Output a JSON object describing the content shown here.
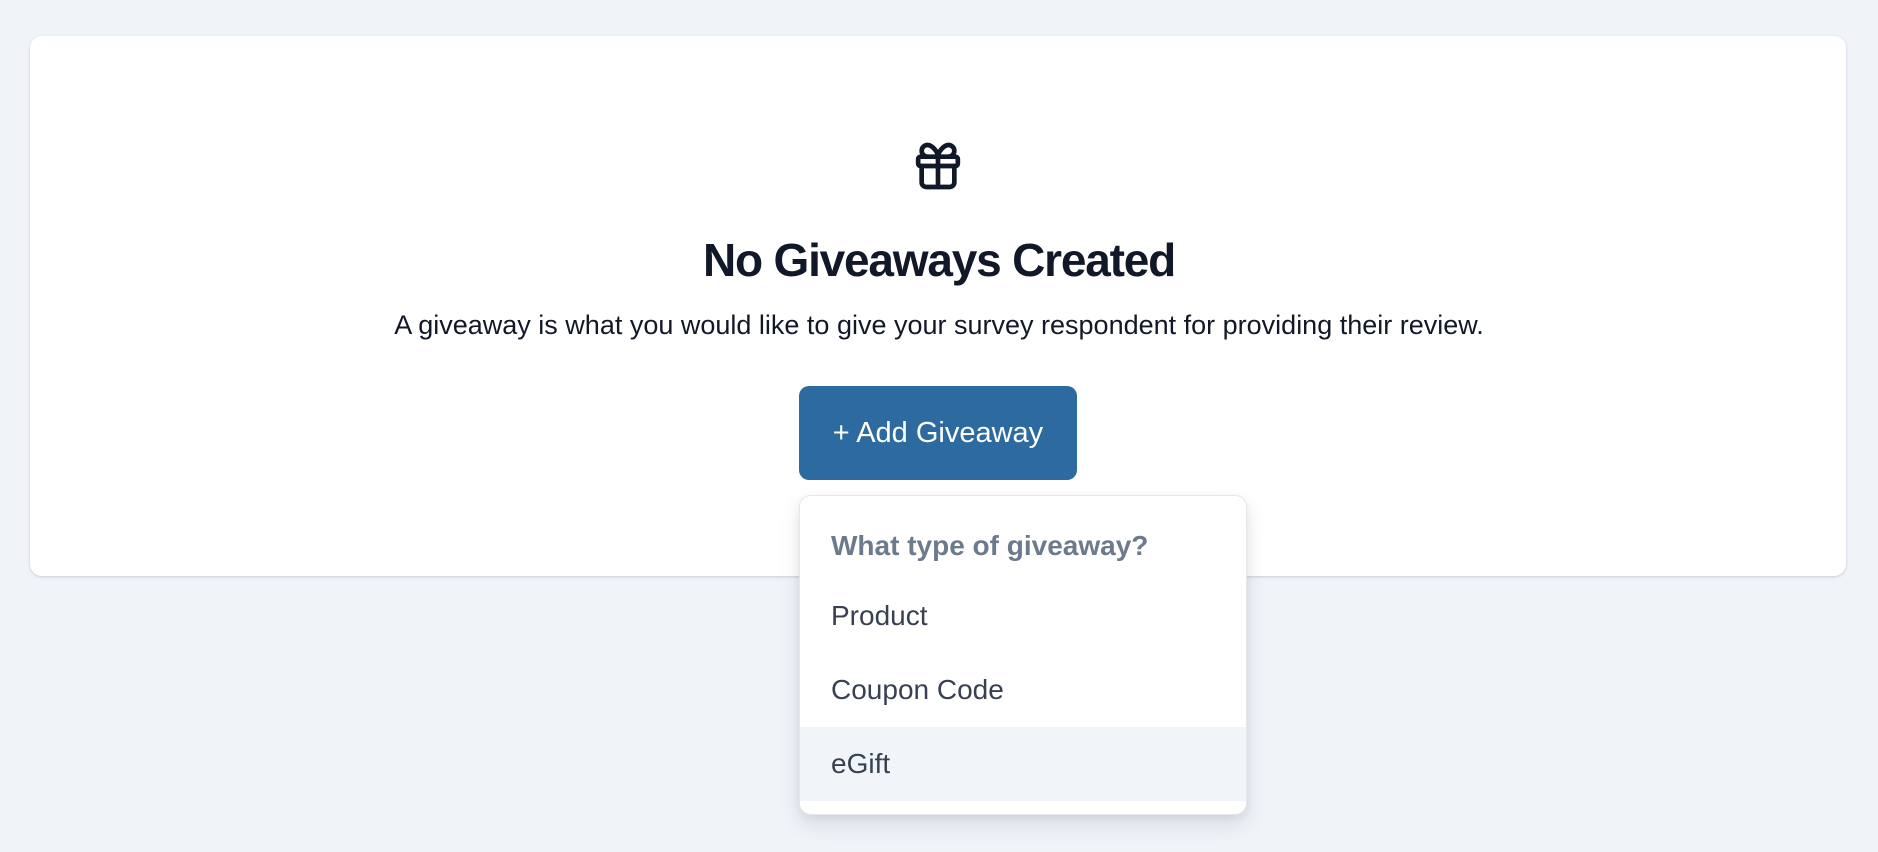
{
  "empty_state": {
    "icon": "gift-icon",
    "title": "No Giveaways Created",
    "description": "A giveaway is what you would like to give your survey respondent for providing their review.",
    "add_button_label": "+ Add Giveaway"
  },
  "dropdown": {
    "heading": "What type of giveaway?",
    "options": [
      {
        "label": "Product"
      },
      {
        "label": "Coupon Code"
      },
      {
        "label": "eGift",
        "highlighted": true
      }
    ]
  },
  "colors": {
    "page_background": "#f0f4f9",
    "card_background": "#ffffff",
    "primary_button": "#2d6a9f",
    "heading_text": "#111827",
    "muted_text": "#6b7a8d",
    "option_hover": "#f1f4f8"
  }
}
